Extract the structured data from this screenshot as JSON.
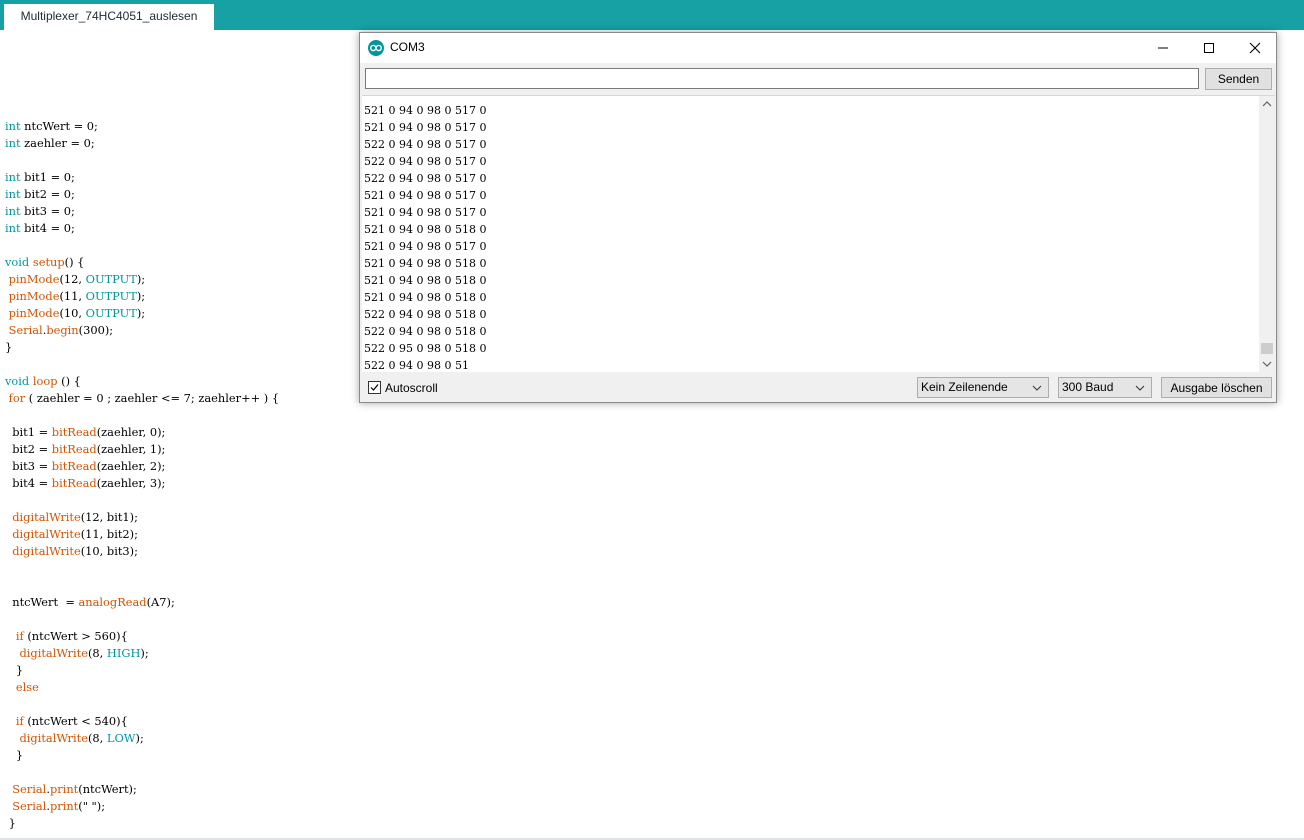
{
  "sketch_tab": {
    "label": "Multiplexer_74HC4051_auslesen"
  },
  "code": {
    "lines": [
      [
        {
          "t": "int",
          "c": "kw"
        },
        {
          "t": " ntcWert = 0;"
        }
      ],
      [
        {
          "t": "int",
          "c": "kw"
        },
        {
          "t": " zaehler = 0;"
        }
      ],
      [],
      [
        {
          "t": "int",
          "c": "kw"
        },
        {
          "t": " bit1 = 0;"
        }
      ],
      [
        {
          "t": "int",
          "c": "kw"
        },
        {
          "t": " bit2 = 0;"
        }
      ],
      [
        {
          "t": "int",
          "c": "kw"
        },
        {
          "t": " bit3 = 0;"
        }
      ],
      [
        {
          "t": "int",
          "c": "kw"
        },
        {
          "t": " bit4 = 0;"
        }
      ],
      [],
      [
        {
          "t": "void",
          "c": "kw"
        },
        {
          "t": " "
        },
        {
          "t": "setup",
          "c": "fn"
        },
        {
          "t": "() {"
        }
      ],
      [
        {
          "t": " "
        },
        {
          "t": "pinMode",
          "c": "fn"
        },
        {
          "t": "(12, "
        },
        {
          "t": "OUTPUT",
          "c": "ct"
        },
        {
          "t": ");"
        }
      ],
      [
        {
          "t": " "
        },
        {
          "t": "pinMode",
          "c": "fn"
        },
        {
          "t": "(11, "
        },
        {
          "t": "OUTPUT",
          "c": "ct"
        },
        {
          "t": ");"
        }
      ],
      [
        {
          "t": " "
        },
        {
          "t": "pinMode",
          "c": "fn"
        },
        {
          "t": "(10, "
        },
        {
          "t": "OUTPUT",
          "c": "ct"
        },
        {
          "t": ");"
        }
      ],
      [
        {
          "t": " "
        },
        {
          "t": "Serial",
          "c": "fn"
        },
        {
          "t": "."
        },
        {
          "t": "begin",
          "c": "fn"
        },
        {
          "t": "(300);"
        }
      ],
      [
        {
          "t": "}"
        }
      ],
      [],
      [
        {
          "t": "void",
          "c": "kw"
        },
        {
          "t": " "
        },
        {
          "t": "loop",
          "c": "fn"
        },
        {
          "t": " () {"
        }
      ],
      [
        {
          "t": " "
        },
        {
          "t": "for",
          "c": "fn"
        },
        {
          "t": " ( zaehler = 0 ; zaehler <= 7; zaehler++ ) {"
        }
      ],
      [],
      [
        {
          "t": "  bit1 = "
        },
        {
          "t": "bitRead",
          "c": "fn"
        },
        {
          "t": "(zaehler, 0);"
        }
      ],
      [
        {
          "t": "  bit2 = "
        },
        {
          "t": "bitRead",
          "c": "fn"
        },
        {
          "t": "(zaehler, 1);"
        }
      ],
      [
        {
          "t": "  bit3 = "
        },
        {
          "t": "bitRead",
          "c": "fn"
        },
        {
          "t": "(zaehler, 2);"
        }
      ],
      [
        {
          "t": "  bit4 = "
        },
        {
          "t": "bitRead",
          "c": "fn"
        },
        {
          "t": "(zaehler, 3);"
        }
      ],
      [],
      [
        {
          "t": "  "
        },
        {
          "t": "digitalWrite",
          "c": "fn"
        },
        {
          "t": "(12, bit1);"
        }
      ],
      [
        {
          "t": "  "
        },
        {
          "t": "digitalWrite",
          "c": "fn"
        },
        {
          "t": "(11, bit2);"
        }
      ],
      [
        {
          "t": "  "
        },
        {
          "t": "digitalWrite",
          "c": "fn"
        },
        {
          "t": "(10, bit3);"
        }
      ],
      [],
      [],
      [
        {
          "t": "  ntcWert  = "
        },
        {
          "t": "analogRead",
          "c": "fn"
        },
        {
          "t": "(A7);"
        }
      ],
      [],
      [
        {
          "t": "   "
        },
        {
          "t": "if",
          "c": "fn"
        },
        {
          "t": " (ntcWert > 560){"
        }
      ],
      [
        {
          "t": "    "
        },
        {
          "t": "digitalWrite",
          "c": "fn"
        },
        {
          "t": "(8, "
        },
        {
          "t": "HIGH",
          "c": "ct"
        },
        {
          "t": ");"
        }
      ],
      [
        {
          "t": "   }"
        }
      ],
      [
        {
          "t": "   "
        },
        {
          "t": "else",
          "c": "fn"
        }
      ],
      [],
      [
        {
          "t": "   "
        },
        {
          "t": "if",
          "c": "fn"
        },
        {
          "t": " (ntcWert < 540){"
        }
      ],
      [
        {
          "t": "    "
        },
        {
          "t": "digitalWrite",
          "c": "fn"
        },
        {
          "t": "(8, "
        },
        {
          "t": "LOW",
          "c": "ct"
        },
        {
          "t": ");"
        }
      ],
      [
        {
          "t": "   }"
        }
      ],
      [],
      [
        {
          "t": "  "
        },
        {
          "t": "Serial",
          "c": "fn"
        },
        {
          "t": "."
        },
        {
          "t": "print",
          "c": "fn"
        },
        {
          "t": "(ntcWert);"
        }
      ],
      [
        {
          "t": "  "
        },
        {
          "t": "Serial",
          "c": "fn"
        },
        {
          "t": "."
        },
        {
          "t": "print",
          "c": "fn"
        },
        {
          "t": "(\" \");"
        }
      ],
      [
        {
          "t": " }"
        }
      ]
    ]
  },
  "serial_monitor": {
    "title": "COM3",
    "input_value": "",
    "send_label": "Senden",
    "output_lines": [
      "521 0 94 0 98 0 517 0",
      "521 0 94 0 98 0 517 0",
      "522 0 94 0 98 0 517 0",
      "522 0 94 0 98 0 517 0",
      "522 0 94 0 98 0 517 0",
      "521 0 94 0 98 0 517 0",
      "521 0 94 0 98 0 517 0",
      "521 0 94 0 98 0 518 0",
      "521 0 94 0 98 0 517 0",
      "521 0 94 0 98 0 518 0",
      "521 0 94 0 98 0 518 0",
      "521 0 94 0 98 0 518 0",
      "522 0 94 0 98 0 518 0",
      "522 0 94 0 98 0 518 0",
      "522 0 95 0 98 0 518 0",
      "522 0 94 0 98 0 51"
    ],
    "autoscroll_label": "Autoscroll",
    "autoscroll_checked": true,
    "line_ending": "Kein Zeilenende",
    "baud_rate": "300 Baud",
    "clear_label": "Ausgabe löschen"
  },
  "colors": {
    "accent": "#17a1a5",
    "keyword": "#00979c",
    "function": "#d35400"
  }
}
